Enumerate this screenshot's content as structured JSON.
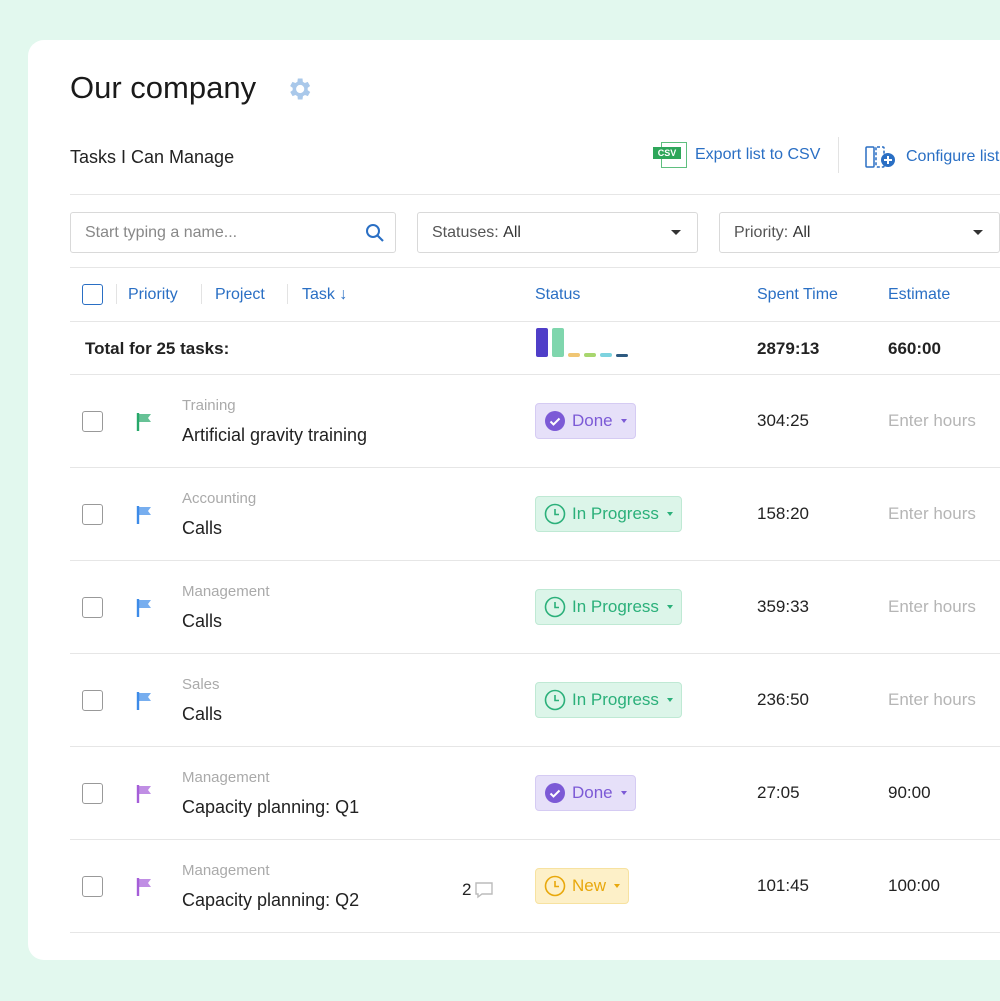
{
  "header": {
    "title": "Our company",
    "subtitle": "Tasks I Can Manage",
    "export_label": "Export list to CSV",
    "csv_badge": "CSV",
    "configure_label": "Configure list"
  },
  "filters": {
    "search_placeholder": "Start typing a name...",
    "statuses_label": "Statuses:",
    "statuses_value": "All",
    "priority_label": "Priority:",
    "priority_value": "All"
  },
  "columns": {
    "priority": "Priority",
    "project": "Project",
    "task": "Task",
    "status": "Status",
    "spent": "Spent Time",
    "estimate": "Estimate"
  },
  "total": {
    "label": "Total for 25 tasks:",
    "spent": "2879:13",
    "estimate": "660:00",
    "status_distribution": [
      {
        "color": "#4f3ec8",
        "value": 8
      },
      {
        "color": "#7fd6ad",
        "value": 8
      },
      {
        "color": "#f0c674",
        "value": 1
      },
      {
        "color": "#a8d66e",
        "value": 1
      },
      {
        "color": "#7dd3df",
        "value": 1
      },
      {
        "color": "#2e5a80",
        "value": 0.5
      }
    ]
  },
  "colors": {
    "done": "#7c5ad6",
    "in_progress": "#2bb07a",
    "new": "#e8a80c",
    "flag_green": "#27a86a",
    "flag_blue": "#3d8be8",
    "flag_purple": "#a55ed8",
    "link": "#2a6fc4"
  },
  "rows": [
    {
      "project": "Training",
      "task": "Artificial gravity training",
      "flag": "green",
      "status": "Done",
      "spent": "304:25",
      "estimate": "Enter hours",
      "est_placeholder": true,
      "comments": ""
    },
    {
      "project": "Accounting",
      "task": "Calls",
      "flag": "blue",
      "status": "In Progress",
      "spent": "158:20",
      "estimate": "Enter hours",
      "est_placeholder": true,
      "comments": ""
    },
    {
      "project": "Management",
      "task": "Calls",
      "flag": "blue",
      "status": "In Progress",
      "spent": "359:33",
      "estimate": "Enter hours",
      "est_placeholder": true,
      "comments": ""
    },
    {
      "project": "Sales",
      "task": "Calls",
      "flag": "blue",
      "status": "In Progress",
      "spent": "236:50",
      "estimate": "Enter hours",
      "est_placeholder": true,
      "comments": ""
    },
    {
      "project": "Management",
      "task": "Capacity planning: Q1",
      "flag": "purple",
      "status": "Done",
      "spent": "27:05",
      "estimate": "90:00",
      "est_placeholder": false,
      "comments": ""
    },
    {
      "project": "Management",
      "task": "Capacity planning: Q2",
      "flag": "purple",
      "status": "New",
      "spent": "101:45",
      "estimate": "100:00",
      "est_placeholder": false,
      "comments": "2"
    }
  ]
}
